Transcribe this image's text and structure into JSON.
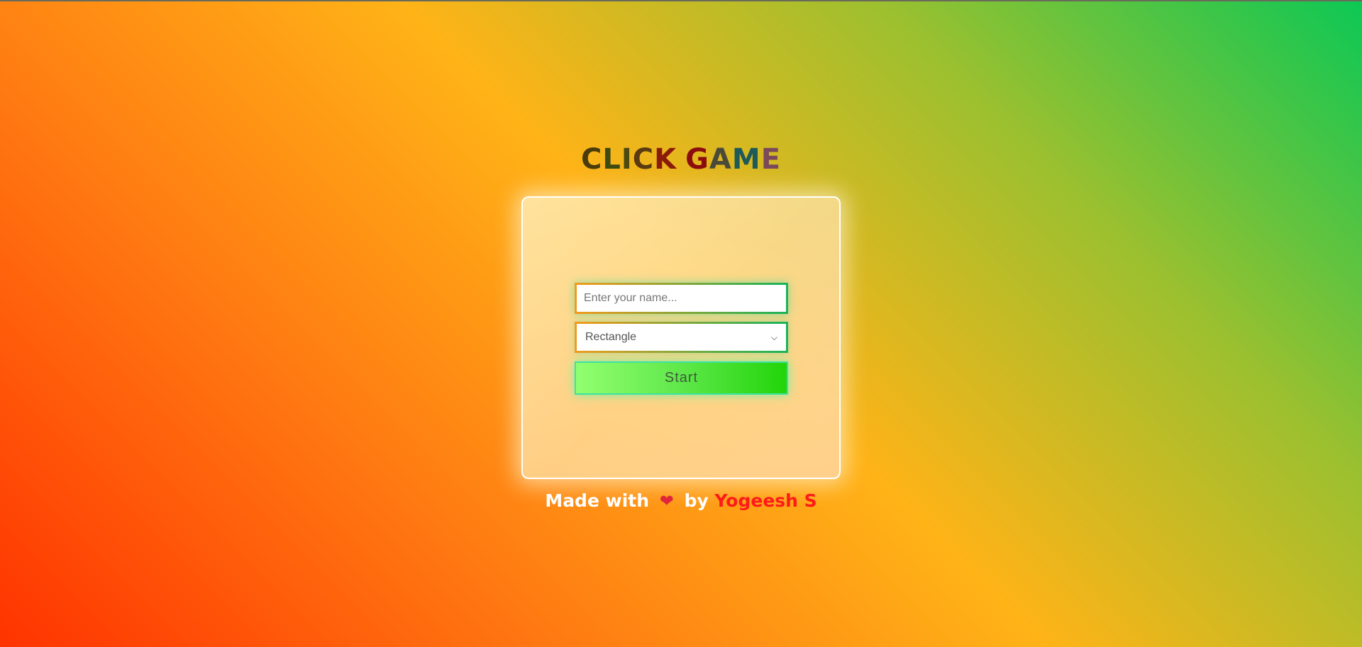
{
  "title": {
    "letters": [
      {
        "char": "C",
        "color": "#4a3b0a"
      },
      {
        "char": "L",
        "color": "#3d4a10"
      },
      {
        "char": "I",
        "color": "#4a4a12"
      },
      {
        "char": "C",
        "color": "#5a3a10"
      },
      {
        "char": "K",
        "color": "#8a1a0a"
      },
      {
        "char": " ",
        "color": "#000000"
      },
      {
        "char": "G",
        "color": "#8b0d0d"
      },
      {
        "char": "A",
        "color": "#4a4a3a"
      },
      {
        "char": "M",
        "color": "#1e5a5a"
      },
      {
        "char": "E",
        "color": "#7a4a5a"
      }
    ]
  },
  "form": {
    "name_placeholder": "Enter your name...",
    "name_value": "",
    "shape_selected": "Rectangle",
    "start_label": "Start"
  },
  "footer": {
    "made_with": "Made with",
    "heart_icon": "❤",
    "by": "by",
    "author": "Yogeesh S"
  }
}
